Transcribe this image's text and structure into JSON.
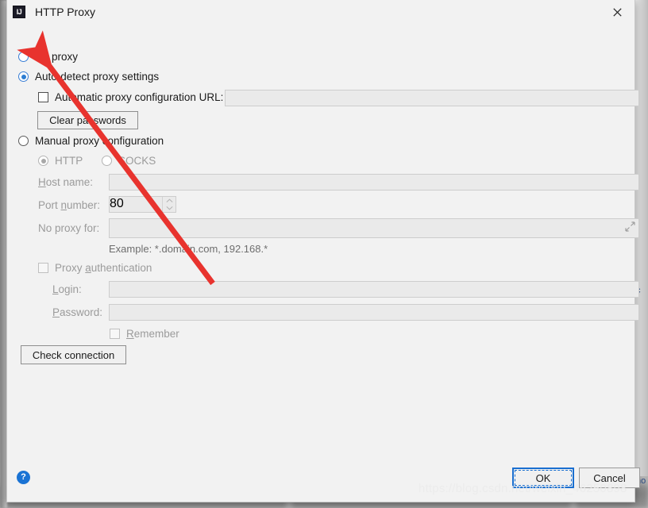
{
  "window": {
    "title": "HTTP Proxy",
    "app_icon": "IJ",
    "close_icon": "close-icon"
  },
  "proxy_mode": {
    "options": [
      {
        "label": "No proxy",
        "selected": false
      },
      {
        "label": "Auto-detect proxy settings",
        "selected": true
      },
      {
        "label": "Manual proxy configuration",
        "selected": false
      }
    ]
  },
  "auto_detect": {
    "pac_checkbox_label": "Automatic proxy configuration URL:",
    "pac_checked": false,
    "pac_url_value": "",
    "clear_passwords_label": "Clear passwords"
  },
  "manual": {
    "protocol": {
      "http_label": "HTTP",
      "http_selected": true,
      "socks_label": "SOCKS",
      "socks_selected": false
    },
    "host_name_label": "Host name:",
    "host_name_value": "",
    "port_number_label": "Port number:",
    "port_number_value": "80",
    "no_proxy_for_label": "No proxy for:",
    "no_proxy_for_value": "",
    "example_hint": "Example: *.domain.com, 192.168.*",
    "expand_icon": "expand-icon",
    "spinner_up_icon": "chevron-up-icon",
    "spinner_down_icon": "chevron-down-icon"
  },
  "authentication": {
    "proxy_auth_label": "Proxy authentication",
    "proxy_auth_checked": false,
    "login_label": "Login:",
    "login_value": "",
    "password_label": "Password:",
    "password_value": "",
    "remember_label": "Remember",
    "remember_checked": false
  },
  "actions": {
    "check_connection_label": "Check connection",
    "help_label": "?",
    "ok_label": "OK",
    "cancel_label": "Cancel"
  },
  "overlay": {
    "watermark": "https://blog.csdn.net/weixin_46250898",
    "annotation_arrow_color": "#e8332e"
  },
  "background": {
    "right_edge_text_1": "c",
    "right_edge_text_2": "no"
  },
  "colors": {
    "dialog_bg": "#f2f2f2",
    "accent_blue": "#2d7dd2",
    "focus_blue": "#1a6fd0",
    "disabled_text": "#9b9b9b",
    "field_bg": "#eaeaea"
  }
}
